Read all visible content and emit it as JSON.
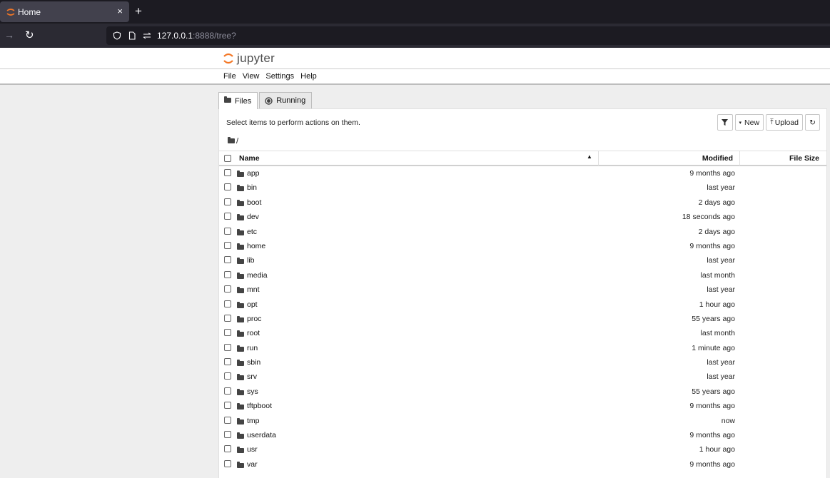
{
  "browser": {
    "tab_title": "Home",
    "tab_close": "×",
    "new_tab": "+",
    "url_host": "127.0.0.1",
    "url_rest": ":8888/tree?"
  },
  "jupyter": {
    "logo_text": "jupyter",
    "menu": [
      "File",
      "View",
      "Settings",
      "Help"
    ]
  },
  "tabs": {
    "files": "Files",
    "running": "Running"
  },
  "panel": {
    "select_message": "Select items to perform actions on them.",
    "new_label": "New",
    "upload_label": "Upload",
    "breadcrumb_sep": "/"
  },
  "table": {
    "headers": {
      "name": "Name",
      "modified": "Modified",
      "size": "File Size"
    },
    "rows": [
      {
        "name": "app",
        "modified": "9 months ago"
      },
      {
        "name": "bin",
        "modified": "last year"
      },
      {
        "name": "boot",
        "modified": "2 days ago"
      },
      {
        "name": "dev",
        "modified": "18 seconds ago"
      },
      {
        "name": "etc",
        "modified": "2 days ago"
      },
      {
        "name": "home",
        "modified": "9 months ago"
      },
      {
        "name": "lib",
        "modified": "last year"
      },
      {
        "name": "media",
        "modified": "last month"
      },
      {
        "name": "mnt",
        "modified": "last year"
      },
      {
        "name": "opt",
        "modified": "1 hour ago"
      },
      {
        "name": "proc",
        "modified": "55 years ago"
      },
      {
        "name": "root",
        "modified": "last month"
      },
      {
        "name": "run",
        "modified": "1 minute ago"
      },
      {
        "name": "sbin",
        "modified": "last year"
      },
      {
        "name": "srv",
        "modified": "last year"
      },
      {
        "name": "sys",
        "modified": "55 years ago"
      },
      {
        "name": "tftpboot",
        "modified": "9 months ago"
      },
      {
        "name": "tmp",
        "modified": "now"
      },
      {
        "name": "userdata",
        "modified": "9 months ago"
      },
      {
        "name": "usr",
        "modified": "1 hour ago"
      },
      {
        "name": "var",
        "modified": "9 months ago"
      }
    ]
  },
  "colors": {
    "jupyter_orange": "#f37726",
    "browser_dark": "#1c1b22"
  }
}
